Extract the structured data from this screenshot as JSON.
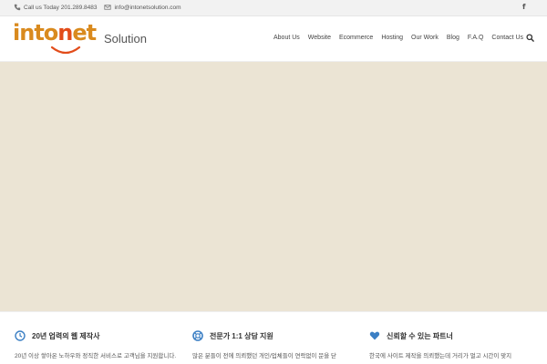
{
  "topbar": {
    "phone": "Call us Today 201.289.8483",
    "email": "info@intonetsolution.com",
    "social": "f"
  },
  "header": {
    "logo": {
      "part1": "into",
      "part2": "n",
      "part3": "et",
      "suffix": "Solution"
    },
    "nav": [
      "About Us",
      "Website",
      "Ecommerce",
      "Hosting",
      "Our Work",
      "Blog",
      "F.A.Q",
      "Contact Us"
    ]
  },
  "hero": {
    "color": "#ebe4d4"
  },
  "features": [
    {
      "icon": "clock-icon",
      "title": "20년 업력의 웹 제작사",
      "body": "20년 이상 쌓아온 노하우와 정직한 서비스로 고객님을 지원합니다.",
      "color": "#3b7fc4"
    },
    {
      "icon": "life-ring-icon",
      "title": "전문가 1:1 상담 지원",
      "body": "많은 분들이 전에 의뢰했던 개인/업체들이 연락없이 문을 닫",
      "color": "#3b7fc4"
    },
    {
      "icon": "heart-icon",
      "title": "신뢰할 수 있는 파트너",
      "body": "한국에 사이트 제작을 의뢰했는데 거리가 멀고 시간이 맞지",
      "color": "#3b7fc4"
    }
  ],
  "colors": {
    "accent": "#e24c1a",
    "logo_orange": "#d98a1e",
    "icon_blue": "#3b7fc4"
  }
}
